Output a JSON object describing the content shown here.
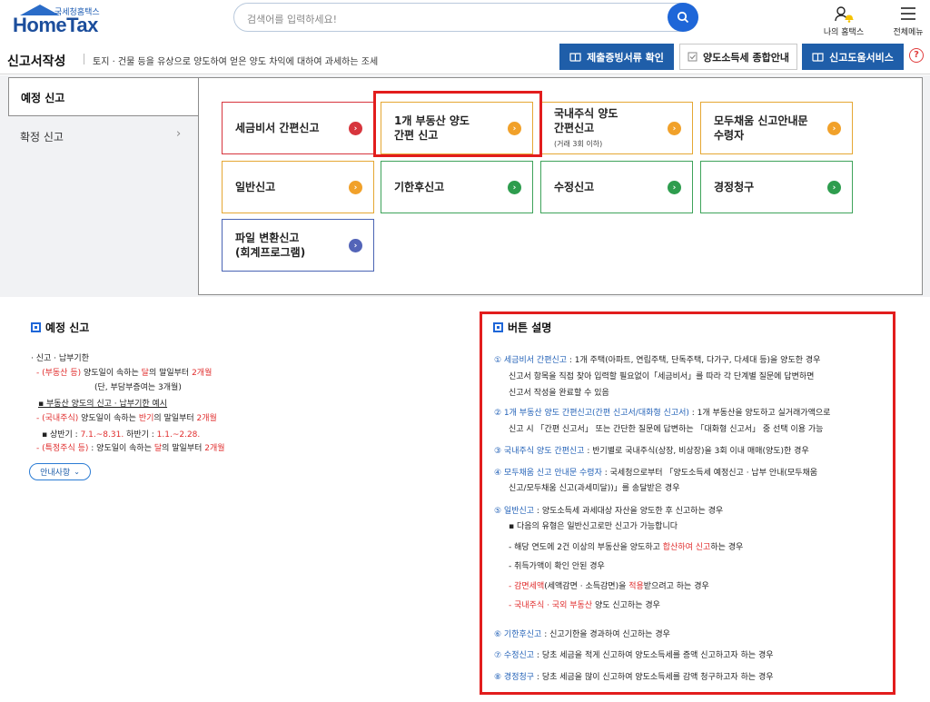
{
  "header": {
    "logo_small": "국세청홈택스",
    "logo_main": "HomeTax",
    "search_placeholder": "검색어를 입력하세요!",
    "my_label": "나의 홈택스",
    "menu_label": "전체메뉴"
  },
  "subbar": {
    "title": "신고서작성",
    "desc": "토지 · 건물 등을 유상으로 양도하여 얻은 양도 차익에 대하여 과세하는 조세",
    "btn_proof": "제출증빙서류 확인",
    "btn_guide": "양도소득세 종합안내",
    "btn_help": "신고도움서비스",
    "help_icon": "?"
  },
  "nav": {
    "active": "예정 신고",
    "item": "확정 신고"
  },
  "cards": [
    {
      "line1": "세금비서 간편신고",
      "line2": "",
      "sub": "",
      "color": "red"
    },
    {
      "line1": "1개 부동산 양도",
      "line2": "간편 신고",
      "sub": "",
      "color": "orange"
    },
    {
      "line1": "국내주식 양도",
      "line2": "간편신고",
      "sub": "(거래 3회 이하)",
      "color": "orange"
    },
    {
      "line1": "모두채움 신고안내문",
      "line2": "수령자",
      "sub": "",
      "color": "orange"
    },
    {
      "line1": "일반신고",
      "line2": "",
      "sub": "",
      "color": "orange"
    },
    {
      "line1": "기한후신고",
      "line2": "",
      "sub": "",
      "color": "green"
    },
    {
      "line1": "수정신고",
      "line2": "",
      "sub": "",
      "color": "green"
    },
    {
      "line1": "경정청구",
      "line2": "",
      "sub": "",
      "color": "green"
    },
    {
      "line1": "파일 변환신고",
      "line2": "(회계프로그램)",
      "sub": "",
      "color": "purple"
    }
  ],
  "left_info": {
    "title": "예정 신고",
    "l1": "· 신고 · 납부기한",
    "l2a": "- (부동산  등)",
    "l2b": " 양도일이 속하는 ",
    "l2c": "달",
    "l2d": "의 말일부터 ",
    "l2e": "2개월",
    "l3": "(단, 부담부증여는 3개월)",
    "l4": "▪ 부동산 양도의 신고 · 납부기한 예시",
    "l5a": "- (국내주식)",
    "l5b": " 양도일이 속하는 ",
    "l5c": "반기",
    "l5d": "의 말일부터 ",
    "l5e": "2개월",
    "l6a": "▪ 상반기 : ",
    "l6b": "7.1.~8.31.",
    "l6c": "   하반기 : ",
    "l6d": "1.1.~2.28.",
    "l7a": "- (특정주식 등)",
    "l7b": " : 양도일이 속하는 ",
    "l7c": "달",
    "l7d": "의 말일부터 ",
    "l7e": "2개월",
    "guide_btn": "안내사항"
  },
  "button_desc": {
    "title": "버튼 설명",
    "d1a": "① 세금비서 간편신고",
    "d1b": " : 1개 주택(아파트, 연립주택, 단독주택, 다가구, 다세대 등)을 양도한 경우",
    "d1c": "신고서 항목을 직접 찾아 입력할 필요없이「세금비서」를 따라 각 단계별 질문에 답변하면",
    "d1d": "신고서 작성을 완료할 수 있음",
    "d2a": "② 1개 부동산 양도 간편신고(간편 신고서/대화형 신고서)",
    "d2b": " : 1개 부동산을 양도하고 실거래가액으로",
    "d2c": "신고 시 「간편 신고서」 또는 간단한 질문에 답변하는 「대화형 신고서」 중 선택 이용 가능",
    "d3a": "③ 국내주식 양도 간편신고",
    "d3b": " : 반기별로 국내주식(상장, 비상장)을 3회 이내 매매(양도)한 경우",
    "d4a": "④ 모두채움 신고 안내문 수령자",
    "d4b": " : 국세청으로부터 「양도소득세 예정신고 · 납부 안내(모두채움",
    "d4c": "신고/모두채움 신고(과세미달))」를 송달받은 경우",
    "d5a": "⑤ 일반신고",
    "d5b": " : 양도소득세 과세대상 자산을 양도한 후 신고하는 경우",
    "d5c": "▪ 다음의 유형은 일반신고로만 신고가 가능합니다",
    "d5d1": "- 해당 연도에 2건 이상의 부동산을 양도하고 ",
    "d5d2": "합산하여 신고",
    "d5d3": "하는 경우",
    "d5e": "- 취득가액이 확인 안된 경우",
    "d5f1": "- 감면세액",
    "d5f2": "(세액감면 · 소득감면)을 ",
    "d5f3": "적용",
    "d5f4": "받으려고 하는 경우",
    "d5g1": "- 국내주식 · 국외 부동산",
    "d5g2": " 양도 신고하는 경우",
    "d6a": "⑥ 기한후신고",
    "d6b": " : 신고기한을 경과하여 신고하는 경우",
    "d7a": "⑦ 수정신고",
    "d7b": " : 당초 세금을 적게 신고하여 양도소득세를 증액 신고하고자 하는 경우",
    "d8a": "⑧ 경정청구",
    "d8b": " : 당초 세금을 많이 신고하여 양도소득세를 감액 청구하고자 하는 경우"
  },
  "colors": {
    "brand": "#1f5ea9",
    "highlight": "#e21d1d"
  }
}
